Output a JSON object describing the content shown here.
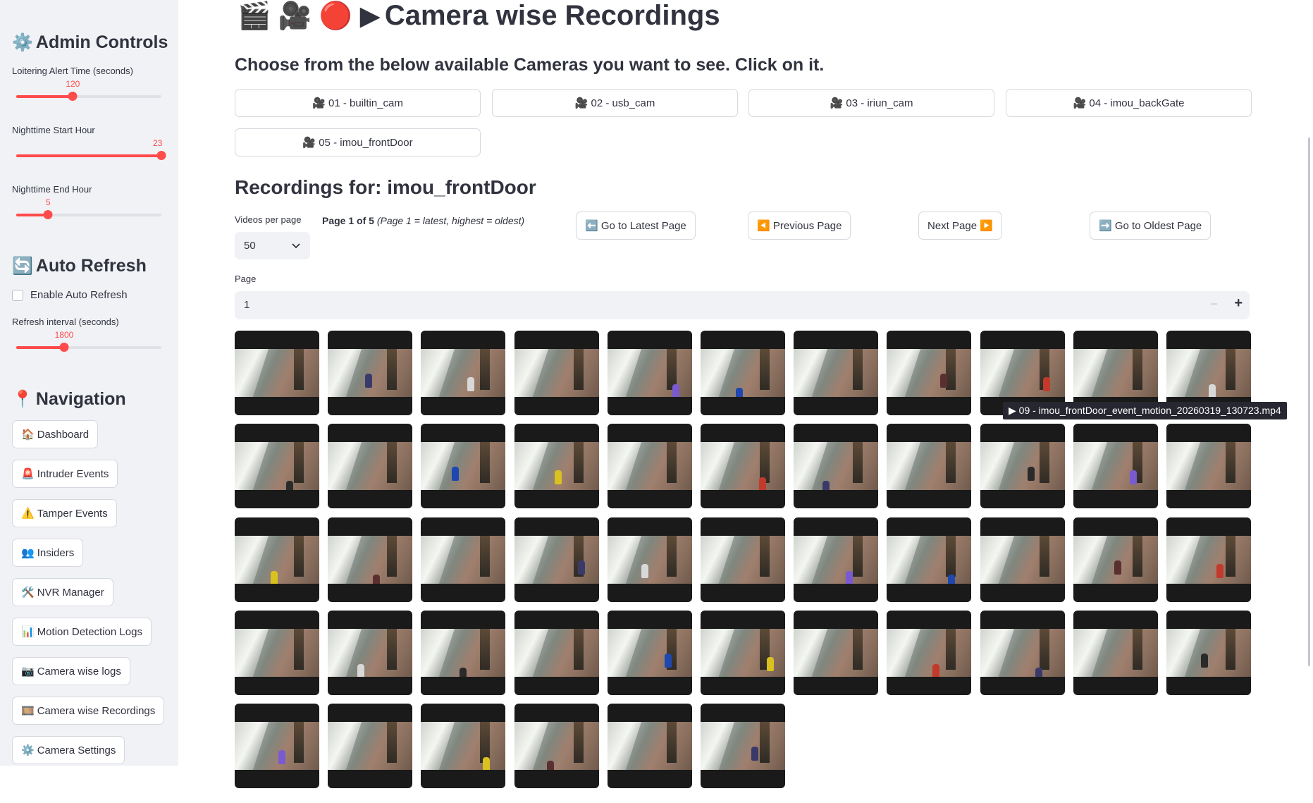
{
  "sidebar": {
    "admin": {
      "icon": "⚙️",
      "title": "Admin Controls"
    },
    "loiter": {
      "label": "Loitering Alert Time (seconds)",
      "value": "120",
      "fraction": 0.39
    },
    "night_start": {
      "label": "Nighttime Start Hour",
      "value": "23",
      "fraction": 1.0
    },
    "night_end": {
      "label": "Nighttime End Hour",
      "value": "5",
      "fraction": 0.22
    },
    "refresh": {
      "icon": "🔄",
      "title": "Auto Refresh"
    },
    "auto_refresh": {
      "label": "Enable Auto Refresh",
      "checked": false
    },
    "interval": {
      "label": "Refresh interval (seconds)",
      "value": "1800",
      "fraction": 0.33
    },
    "navigation": {
      "icon": "📍",
      "title": "Navigation"
    },
    "nav_items": [
      {
        "icon": "🏠",
        "label": "Dashboard"
      },
      {
        "icon": "🚨",
        "label": "Intruder Events"
      },
      {
        "icon": "⚠️",
        "label": "Tamper Events"
      },
      {
        "icon": "👥",
        "label": "Insiders"
      },
      {
        "icon": "🛠️",
        "label": "NVR Manager"
      },
      {
        "icon": "📊",
        "label": "Motion Detection Logs"
      },
      {
        "icon": "📷",
        "label": "Camera wise logs"
      },
      {
        "icon": "🎞️",
        "label": "Camera wise Recordings"
      },
      {
        "icon": "⚙️",
        "label": "Camera Settings"
      }
    ]
  },
  "main": {
    "title_icons": "🎬 🎥 🔴 ▶",
    "title": "Camera wise Recordings",
    "subtitle": "Choose from the below available Cameras you want to see. Click on it.",
    "cameras": [
      {
        "icon": "🎥",
        "label": "01 - builtin_cam"
      },
      {
        "icon": "🎥",
        "label": "02 - usb_cam"
      },
      {
        "icon": "🎥",
        "label": "03 - iriun_cam"
      },
      {
        "icon": "🎥",
        "label": "04 - imou_backGate"
      },
      {
        "icon": "🎥",
        "label": "05 - imou_frontDoor"
      }
    ],
    "recordings_heading": "Recordings for: imou_frontDoor",
    "videos_per_page_label": "Videos per page",
    "videos_per_page": "50",
    "page_info_bold": "Page 1 of 5",
    "page_info_italic": "(Page 1 = latest, highest = oldest)",
    "buttons": {
      "latest": {
        "icon": "⬅️",
        "label": "Go to Latest Page"
      },
      "previous": {
        "icon": "◀️",
        "label": "Previous Page"
      },
      "next": {
        "icon": "▶️",
        "label": "Next Page"
      },
      "oldest": {
        "icon": "➡️",
        "label": "Go to Oldest Page"
      }
    },
    "page_label": "Page",
    "page_value": "1",
    "stepper_minus": "−",
    "stepper_plus": "+",
    "thumbnail_count": 50,
    "tooltip": "▶ 09 - imou_frontDoor_event_motion_20260319_130723.mp4"
  },
  "colors": {
    "accent": "#ff4b4b",
    "sidebar_bg": "#f0f2f6",
    "text": "#31333f"
  }
}
